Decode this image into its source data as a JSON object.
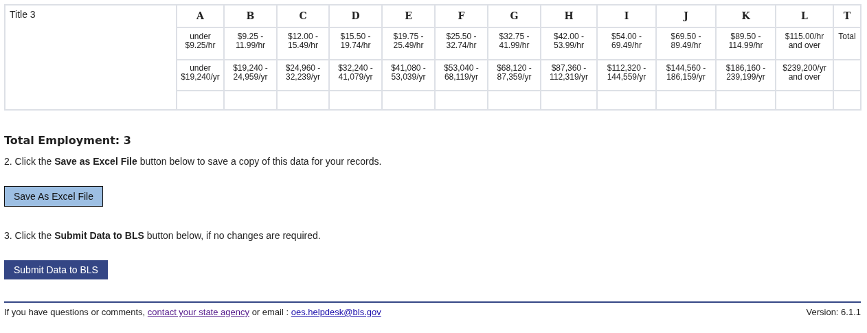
{
  "table": {
    "title": "Title 3",
    "columns": [
      {
        "letter": "A",
        "hourly": [
          "under",
          "$9.25/hr"
        ],
        "annual": [
          "under",
          "$19,240/yr"
        ]
      },
      {
        "letter": "B",
        "hourly": [
          "$9.25 -",
          "11.99/hr"
        ],
        "annual": [
          "$19,240 -",
          "24,959/yr"
        ]
      },
      {
        "letter": "C",
        "hourly": [
          "$12.00 -",
          "15.49/hr"
        ],
        "annual": [
          "$24,960 -",
          "32,239/yr"
        ]
      },
      {
        "letter": "D",
        "hourly": [
          "$15.50 -",
          "19.74/hr"
        ],
        "annual": [
          "$32,240 -",
          "41,079/yr"
        ]
      },
      {
        "letter": "E",
        "hourly": [
          "$19.75 -",
          "25.49/hr"
        ],
        "annual": [
          "$41,080 -",
          "53,039/yr"
        ]
      },
      {
        "letter": "F",
        "hourly": [
          "$25.50 -",
          "32.74/hr"
        ],
        "annual": [
          "$53,040 -",
          "68,119/yr"
        ]
      },
      {
        "letter": "G",
        "hourly": [
          "$32.75 -",
          "41.99/hr"
        ],
        "annual": [
          "$68,120 -",
          "87,359/yr"
        ]
      },
      {
        "letter": "H",
        "hourly": [
          "$42.00 -",
          "53.99/hr"
        ],
        "annual": [
          "$87,360 -",
          "112,319/yr"
        ]
      },
      {
        "letter": "I",
        "hourly": [
          "$54.00 -",
          "69.49/hr"
        ],
        "annual": [
          "$112,320 -",
          "144,559/yr"
        ]
      },
      {
        "letter": "J",
        "hourly": [
          "$69.50 -",
          "89.49/hr"
        ],
        "annual": [
          "$144,560 -",
          "186,159/yr"
        ]
      },
      {
        "letter": "K",
        "hourly": [
          "$89.50 -",
          "114.99/hr"
        ],
        "annual": [
          "$186,160 -",
          "239,199/yr"
        ]
      },
      {
        "letter": "L",
        "hourly": [
          "$115.00/hr",
          "and over"
        ],
        "annual": [
          "$239,200/yr",
          "and over"
        ]
      },
      {
        "letter": "T",
        "hourly": [
          "Total"
        ]
      }
    ]
  },
  "total_employment": "Total Employment: 3",
  "step2": "2. Click the **Save as Excel File** button below to save a copy of this data for your records.",
  "save_button": "Save As Excel File",
  "step3": "3. Click the **Submit Data to BLS** button below, if no changes are required.",
  "submit_button": "Submit Data to BLS",
  "footer": {
    "prefix": "If you have questions or comments,",
    "link": "contact your state agency",
    "middle": "or email :",
    "email": "oes.helpdesk@bls.gov",
    "version": "Version: 6.1.1"
  }
}
